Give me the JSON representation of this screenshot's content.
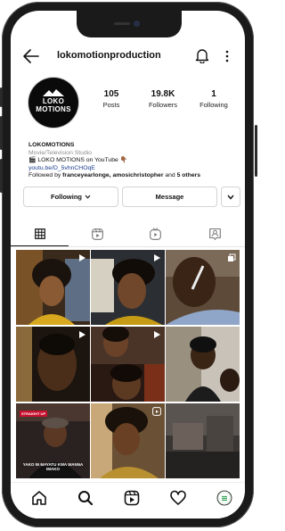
{
  "header": {
    "username": "lokomotionproduction"
  },
  "avatar": {
    "logo_text": "LOKO MOTIONS"
  },
  "stats": [
    {
      "value": "105",
      "label": "Posts"
    },
    {
      "value": "19.8K",
      "label": "Followers"
    },
    {
      "value": "1",
      "label": "Following"
    }
  ],
  "bio": {
    "name": "LOKOMOTIONS",
    "category": "Movie/Television Studio",
    "line1_prefix_emoji": "🎬",
    "line1": "LOKO MOTIONS on YouTube",
    "line1_suffix_emoji": "👇🏾",
    "link": "youtu.be/D_5vhnCHOqE",
    "followed_prefix": "Followed by ",
    "followed_users": "franceyearlonge, amosichristopher",
    "followed_mid": " and ",
    "followed_others": "5 others"
  },
  "actions": {
    "following_label": "Following",
    "message_label": "Message"
  },
  "tabs": [
    "grid-icon",
    "reels-icon",
    "igtv-icon",
    "tagged-icon"
  ],
  "grid": {
    "cells": [
      {
        "type": "reel",
        "icon": "play-icon"
      },
      {
        "type": "reel",
        "icon": "play-icon"
      },
      {
        "type": "carousel",
        "icon": "carousel-icon"
      },
      {
        "type": "reel",
        "icon": "play-icon"
      },
      {
        "type": "reel",
        "icon": "play-icon"
      },
      {
        "type": "image",
        "icon": ""
      },
      {
        "type": "image",
        "icon": "",
        "tag": "STRAIGHT UP",
        "caption": "YAKO IN MAYATU KWA WANNA IMAKO"
      },
      {
        "type": "reel",
        "icon": "reels-small-icon"
      },
      {
        "type": "image",
        "icon": ""
      }
    ]
  },
  "nav": [
    "home-icon",
    "search-icon",
    "reels-icon",
    "heart-icon",
    "profile-icon"
  ],
  "colors": {
    "link": "#1a3d8f",
    "border": "#d4d4d4",
    "profile_dot": "#3ca55c"
  }
}
